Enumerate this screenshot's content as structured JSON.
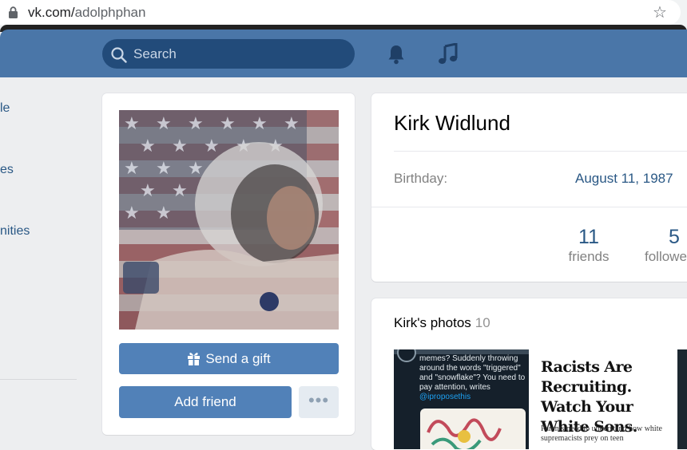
{
  "browser": {
    "url_host": "vk.com/",
    "url_path": "adolphphan"
  },
  "header": {
    "search_placeholder": "Search"
  },
  "sidebar": {
    "items": [
      {
        "label": "le"
      },
      {
        "label": "es"
      },
      {
        "label": "nities"
      }
    ]
  },
  "profile": {
    "name": "Kirk Widlund",
    "birthday_label": "Birthday:",
    "birthday_value": "August 11, 1987",
    "send_gift_label": "Send a gift",
    "add_friend_label": "Add friend",
    "more_label": "•••",
    "stats": [
      {
        "count": "11",
        "label": "friends"
      },
      {
        "count": "5",
        "label": "followe"
      }
    ]
  },
  "photos": {
    "title": "Kirk's photos",
    "count": "10",
    "tweet_text": "memes? Suddenly throwing around the words \"triggered\" and \"snowflake\"? You need to pay attention, writes",
    "tweet_handle": "@iproposethis",
    "article_headline": "Racists Are Recruiting. Watch Your White Sons.",
    "article_sub": "Parents need to understand how white supremacists prey on teen"
  },
  "colors": {
    "header_bg": "#4a76a8",
    "search_bg": "#224b7a",
    "button_primary": "#5181b8",
    "link": "#2a5885",
    "page_bg": "#edeef0"
  },
  "icons": [
    "lock-icon",
    "star-icon",
    "search-icon",
    "bell-icon",
    "music-icon",
    "gift-icon"
  ]
}
